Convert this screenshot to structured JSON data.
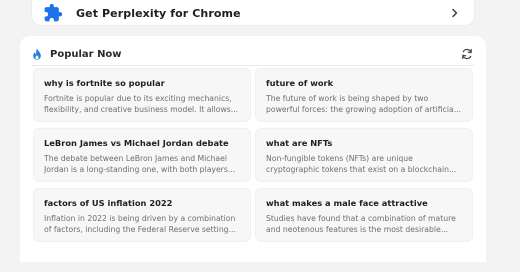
{
  "extension": {
    "label": "Get Perplexity for Chrome",
    "icon": "puzzle-piece-icon",
    "accent": "#1a73e8"
  },
  "popular": {
    "title": "Popular Now",
    "icon": "fire-icon",
    "refresh_icon": "refresh-icon",
    "accent": "#1f7fe0",
    "items": [
      {
        "title": "why is fortnite so popular",
        "desc": "Fortnite is popular due to its exciting mechanics, flexibility, and creative business model. It allows..."
      },
      {
        "title": "future of work",
        "desc": "The future of work is being shaped by two powerful forces: the growing adoption of artificia..."
      },
      {
        "title": "LeBron James vs Michael Jordan debate",
        "desc": "The debate between LeBron James and Michael Jordan is a long-standing one, with both players..."
      },
      {
        "title": "what are NFTs",
        "desc": "Non-fungible tokens (NFTs) are unique cryptographic tokens that exist on a blockchain..."
      },
      {
        "title": "factors of US inflation 2022",
        "desc": "Inflation in 2022 is being driven by a combination of factors, including the Federal Reserve setting..."
      },
      {
        "title": "what makes a male face attractive",
        "desc": "Studies have found that a combination of mature and neotenous features is the most desirable..."
      }
    ]
  }
}
